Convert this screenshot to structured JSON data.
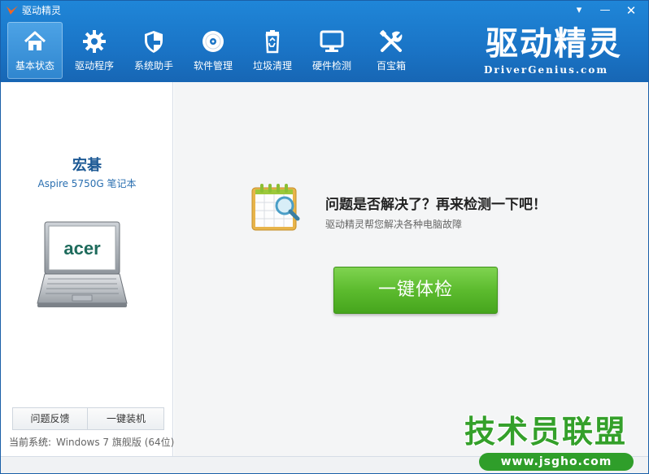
{
  "window": {
    "title": "驱动精灵"
  },
  "window_controls": {
    "menu": "▾",
    "minimize": "—",
    "close": "✕"
  },
  "nav": {
    "items": [
      {
        "label": "基本状态",
        "icon": "home-icon",
        "active": true
      },
      {
        "label": "驱动程序",
        "icon": "gear-icon",
        "active": false
      },
      {
        "label": "系统助手",
        "icon": "shield-icon",
        "active": false
      },
      {
        "label": "软件管理",
        "icon": "disc-icon",
        "active": false
      },
      {
        "label": "垃圾清理",
        "icon": "recycle-bin-icon",
        "active": false
      },
      {
        "label": "硬件检测",
        "icon": "monitor-icon",
        "active": false
      },
      {
        "label": "百宝箱",
        "icon": "tools-icon",
        "active": false
      }
    ]
  },
  "brand": {
    "logo_cn": "驱动精灵",
    "logo_en": "DriverGenius.com"
  },
  "device": {
    "brand": "宏碁",
    "model": "Aspire 5750G 笔记本",
    "laptop_logo": "acer"
  },
  "left_buttons": {
    "feedback": "问题反馈",
    "install": "一键装机"
  },
  "system": {
    "label": "当前系统:",
    "value": "Windows 7 旗舰版 (64位)"
  },
  "main": {
    "headline": "问题是否解决了？再来检测一下吧！",
    "subline": "驱动精灵帮您解决各种电脑故障",
    "check_button": "一键体检"
  },
  "watermark": {
    "cn": "技术员联盟",
    "url": "www.jsgho.com"
  },
  "colors": {
    "header_blue": "#1a74c6",
    "button_green": "#5cbb2e",
    "brand_text": "#1e5a95",
    "watermark_green": "#34a02a"
  }
}
